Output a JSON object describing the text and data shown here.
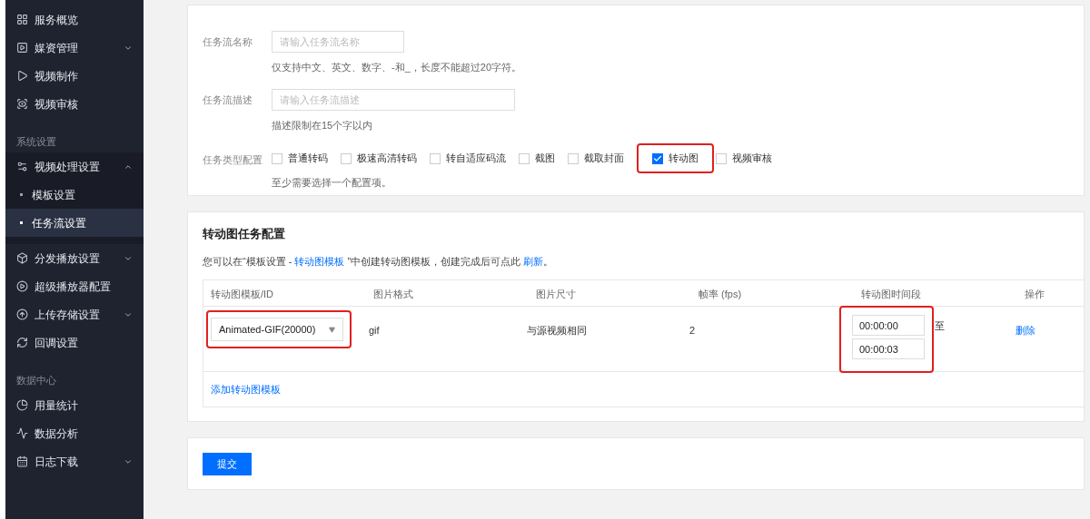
{
  "sidebar": {
    "items": [
      {
        "kind": "item",
        "label": "服务概览"
      },
      {
        "kind": "item",
        "label": "媒资管理",
        "expanded": false
      },
      {
        "kind": "item",
        "label": "视频制作"
      },
      {
        "kind": "item",
        "label": "视频审核"
      },
      {
        "kind": "section",
        "label": "系统设置"
      },
      {
        "kind": "item",
        "label": "视频处理设置",
        "expanded": true,
        "children": [
          {
            "label": "模板设置",
            "selected": false
          },
          {
            "label": "任务流设置",
            "selected": true
          }
        ]
      },
      {
        "kind": "item",
        "label": "分发播放设置",
        "expanded": false
      },
      {
        "kind": "item",
        "label": "超级播放器配置"
      },
      {
        "kind": "item",
        "label": "上传存储设置",
        "expanded": false
      },
      {
        "kind": "item",
        "label": "回调设置"
      },
      {
        "kind": "section",
        "label": "数据中心"
      },
      {
        "kind": "item",
        "label": "用量统计"
      },
      {
        "kind": "item",
        "label": "数据分析"
      },
      {
        "kind": "item",
        "label": "日志下载",
        "expanded": false
      }
    ]
  },
  "form": {
    "name": {
      "label": "任务流名称",
      "placeholder": "请输入任务流名称",
      "hint": "仅支持中文、英文、数字、-和_，长度不能超过20字符。"
    },
    "description": {
      "label": "任务流描述",
      "placeholder": "请输入任务流描述",
      "hint": "描述限制在15个字以内"
    },
    "task_types": {
      "label": "任务类型配置",
      "options": [
        {
          "label": "普通转码",
          "checked": false,
          "highlighted": false
        },
        {
          "label": "极速高清转码",
          "checked": false,
          "highlighted": false
        },
        {
          "label": "转自适应码流",
          "checked": false,
          "highlighted": false
        },
        {
          "label": "截图",
          "checked": false,
          "highlighted": false
        },
        {
          "label": "截取封面",
          "checked": false,
          "highlighted": false
        },
        {
          "label": "转动图",
          "checked": true,
          "highlighted": true
        },
        {
          "label": "视频审核",
          "checked": false,
          "highlighted": false
        }
      ],
      "hint": "至少需要选择一个配置项。"
    }
  },
  "animated_config": {
    "title": "转动图任务配置",
    "intro": [
      {
        "kind": "text",
        "text": "您可以在“模板设置 - "
      },
      {
        "kind": "link",
        "text": "转动图模板"
      },
      {
        "kind": "text",
        "text": " ”中创建转动图模板，创建完成后可点此 "
      },
      {
        "kind": "link",
        "text": "刷新"
      },
      {
        "kind": "text",
        "text": "。"
      }
    ],
    "table": {
      "columns": [
        "转动图模板/ID",
        "图片格式",
        "图片尺寸",
        "帧率 (fps)",
        "转动图时间段",
        "操作"
      ],
      "rows": [
        {
          "template": {
            "value": "Animated-GIF(20000)",
            "highlighted": true
          },
          "format": "gif",
          "size": "与源视频相同",
          "fps": "2",
          "time_range": {
            "start": "00:00:00",
            "end": "00:00:03",
            "separator": "至",
            "highlighted": true
          },
          "action": "删除"
        }
      ],
      "add_link": "添加转动图模板"
    }
  },
  "submit": "提交"
}
